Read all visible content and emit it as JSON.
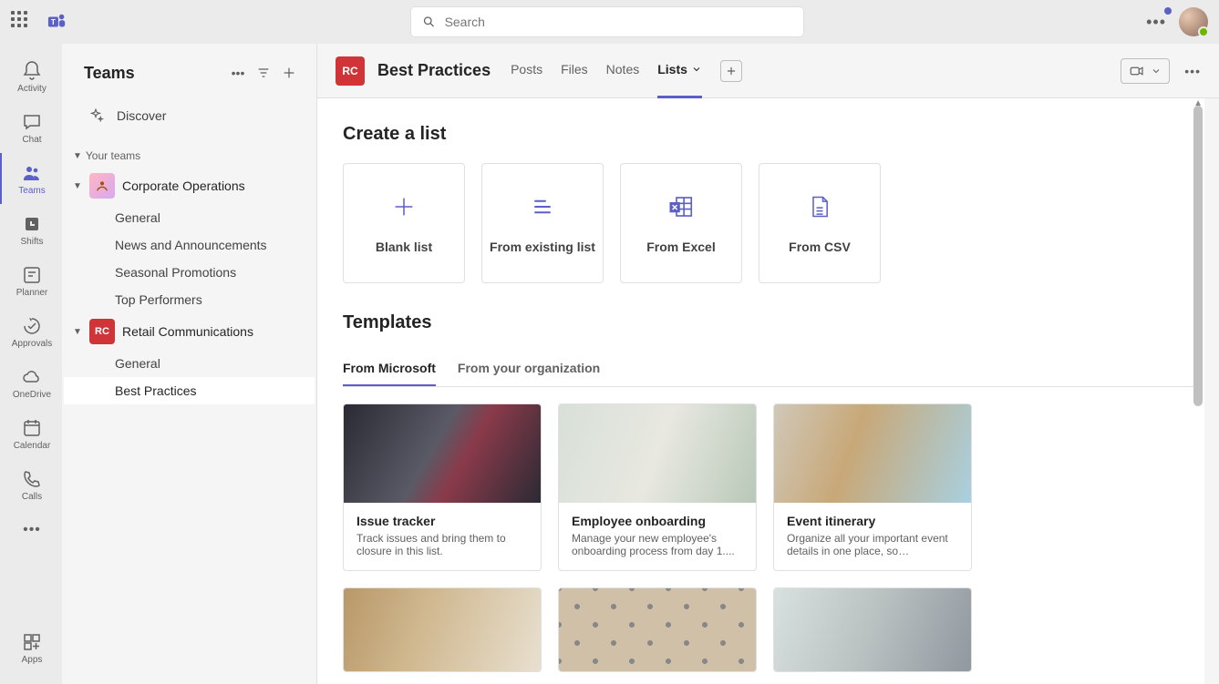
{
  "search": {
    "placeholder": "Search"
  },
  "rail": {
    "activity": "Activity",
    "chat": "Chat",
    "teams": "Teams",
    "shifts": "Shifts",
    "planner": "Planner",
    "approvals": "Approvals",
    "onedrive": "OneDrive",
    "calendar": "Calendar",
    "calls": "Calls",
    "apps": "Apps"
  },
  "sidebar": {
    "title": "Teams",
    "discover": "Discover",
    "yourTeams": "Your teams",
    "teams": [
      {
        "abbr": "",
        "name": "Corporate Operations",
        "channels": [
          "General",
          "News and Announcements",
          "Seasonal Promotions",
          "Top Performers"
        ]
      },
      {
        "abbr": "RC",
        "name": "Retail Communications",
        "channels": [
          "General",
          "Best Practices"
        ]
      }
    ]
  },
  "channel": {
    "abbr": "RC",
    "title": "Best Practices",
    "tabs": [
      "Posts",
      "Files",
      "Notes",
      "Lists"
    ],
    "activeTab": "Lists"
  },
  "lists": {
    "createTitle": "Create a list",
    "createOptions": [
      "Blank list",
      "From existing list",
      "From Excel",
      "From CSV"
    ],
    "templatesTitle": "Templates",
    "templateTabs": [
      "From Microsoft",
      "From your organization"
    ],
    "templates": [
      {
        "name": "Issue tracker",
        "desc": "Track issues and bring them to closure in this list."
      },
      {
        "name": "Employee onboarding",
        "desc": "Manage your new employee's onboarding process from day 1...."
      },
      {
        "name": "Event itinerary",
        "desc": "Organize all your important event details in one place, so everything..."
      }
    ]
  }
}
